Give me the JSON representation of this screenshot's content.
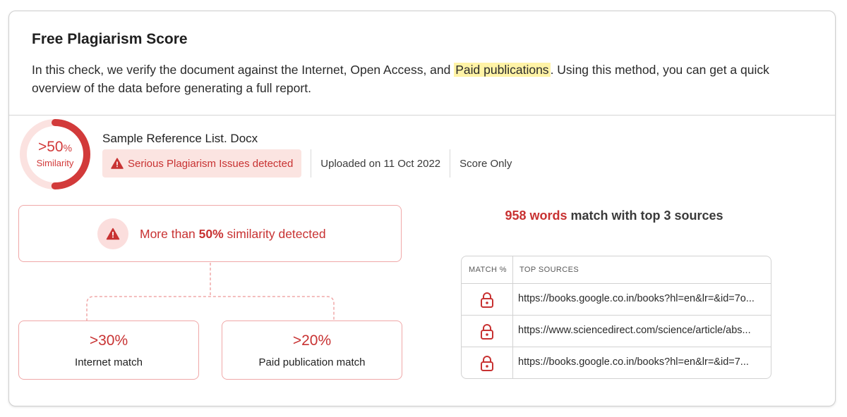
{
  "header": {
    "title": "Free Plagiarism Score",
    "desc_before": "In this check, we verify the document against the Internet, Open Access, and ",
    "desc_highlight": "Paid publications",
    "desc_after": ". Using this method, you can get a quick overview of the data before generating a full report."
  },
  "score": {
    "value": ">50",
    "unit": "%",
    "label": "Similarity",
    "ring_fraction": 0.5,
    "color": "#d23a3a"
  },
  "document": {
    "filename": "Sample Reference List. Docx",
    "issue_badge": "Serious Plagiarism Issues detected",
    "uploaded": "Uploaded on 11 Oct 2022",
    "mode": "Score Only"
  },
  "summary": {
    "prefix": "More than ",
    "value": "50%",
    "suffix": " similarity detected"
  },
  "breakdown": [
    {
      "value": ">30%",
      "label": "Internet match"
    },
    {
      "value": ">20%",
      "label": "Paid publication match"
    }
  ],
  "sources": {
    "words_count": "958 words",
    "words_suffix": " match with top 3 sources",
    "col_match": "MATCH %",
    "col_sources": "TOP SOURCES",
    "rows": [
      {
        "icon": "lock-icon",
        "url": "https://books.google.co.in/books?hl=en&lr=&id=7o..."
      },
      {
        "icon": "lock-icon",
        "url": "https://www.sciencedirect.com/science/article/abs..."
      },
      {
        "icon": "lock-icon",
        "url": "https://books.google.co.in/books?hl=en&lr=&id=7..."
      }
    ]
  },
  "colors": {
    "accent": "#c83232",
    "badge_bg": "#fbe4e1",
    "highlight": "#fff3a6"
  }
}
